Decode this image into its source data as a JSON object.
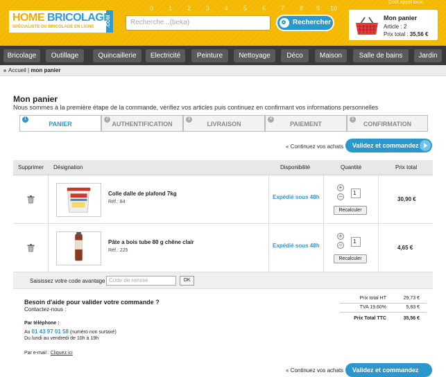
{
  "header": {
    "logo_main_1": "HOME ",
    "logo_main_2": "BRICOLAGE",
    "logo_sub": "SPÉCIALISTE DU BRICOLAGE EN LIGNE",
    "logo_com": ".COM",
    "digits": [
      "0",
      "1",
      "2",
      "3",
      "4",
      "5",
      "6",
      "7",
      "8",
      "9",
      "10"
    ],
    "search_placeholder": "Recherche...(beka)",
    "search_button": "Rechercher",
    "top_link": "Coût appel local",
    "cart": {
      "title": "Mon panier",
      "count": "Article : 2",
      "total_label": "Prix total : ",
      "total_value": "35,56 €"
    }
  },
  "nav": {
    "items": [
      "Bricolage",
      "Outillage",
      "Quincaillerie",
      "Electricité",
      "Peinture",
      "Nettoyage",
      "Déco",
      "Maison",
      "Salle de bains",
      "Jardin"
    ]
  },
  "breadcrumb": {
    "home": "Accueil",
    "sep": " | ",
    "current": "mon panier"
  },
  "page": {
    "title": "Mon panier",
    "subtitle": "Nous sommes à la première étape de la commande, vérifiez vos articles puis continuez en confirmant vos informations personnelles"
  },
  "steps": [
    {
      "num": "1",
      "label": "PANIER"
    },
    {
      "num": "2",
      "label": "AUTHENTIFICATION"
    },
    {
      "num": "3",
      "label": "LIVRAISON"
    },
    {
      "num": "4",
      "label": "PAIEMENT"
    },
    {
      "num": "5",
      "label": "CONFIRMATION"
    }
  ],
  "actions": {
    "continue": "« Continuez vos achats",
    "validate": "Validez et commandez"
  },
  "table": {
    "headers": [
      "Supprimer",
      "Désignation",
      "Disponibilité",
      "Quantité",
      "Prix total"
    ],
    "rows": [
      {
        "name": "Colle dalle de plafond 7kg",
        "ref": "Réf.: 84",
        "availability": "Expédié sous 48h",
        "quantity": "1",
        "recalc": "Recalculer",
        "price": "30,90 €"
      },
      {
        "name": "Pâte a bois tube 80 g chêne clair",
        "ref": "Réf.: 225",
        "availability": "Expédié sous 48h",
        "quantity": "1",
        "recalc": "Recalculer",
        "price": "4,65 €"
      }
    ]
  },
  "promo": {
    "label": "Saisissez votre code avantage",
    "placeholder": "Code de remise",
    "ok": "OK"
  },
  "help": {
    "title": "Besoin d'aide pour valider votre commande ?",
    "contact": "Contactez-nous :",
    "phone_label": "Par téléphone :",
    "phone_prefix": "Au ",
    "phone_number": "01 43 97 01 58",
    "phone_suffix": " (numéro non surtaxé)",
    "hours": "Du lundi au vendredi de 10h à 19h",
    "email_label": "Par e-mail : ",
    "email_link": "Cliquez ici"
  },
  "totals": [
    {
      "label": "Prix total HT",
      "value": "29,73 €"
    },
    {
      "label": "TVA 19,60%",
      "value": "5,83 €"
    },
    {
      "label": "Prix Total TTC",
      "value": "35,56 €"
    }
  ],
  "colors": {
    "header_yellow": "#f5b800",
    "accent_blue": "#2b97cc",
    "nav_dark": "#3a3a3a"
  }
}
